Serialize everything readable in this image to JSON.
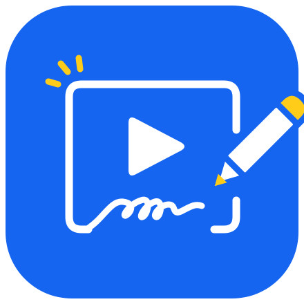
{
  "app_icon": {
    "name": "video-signature-app-icon",
    "colors": {
      "background": "#1565f0",
      "foreground": "#ffffff",
      "accent": "#ffcc1a"
    },
    "glyphs": [
      "sparkle-icon",
      "screen-frame-icon",
      "play-icon",
      "signature-scribble-icon",
      "pencil-icon"
    ]
  }
}
